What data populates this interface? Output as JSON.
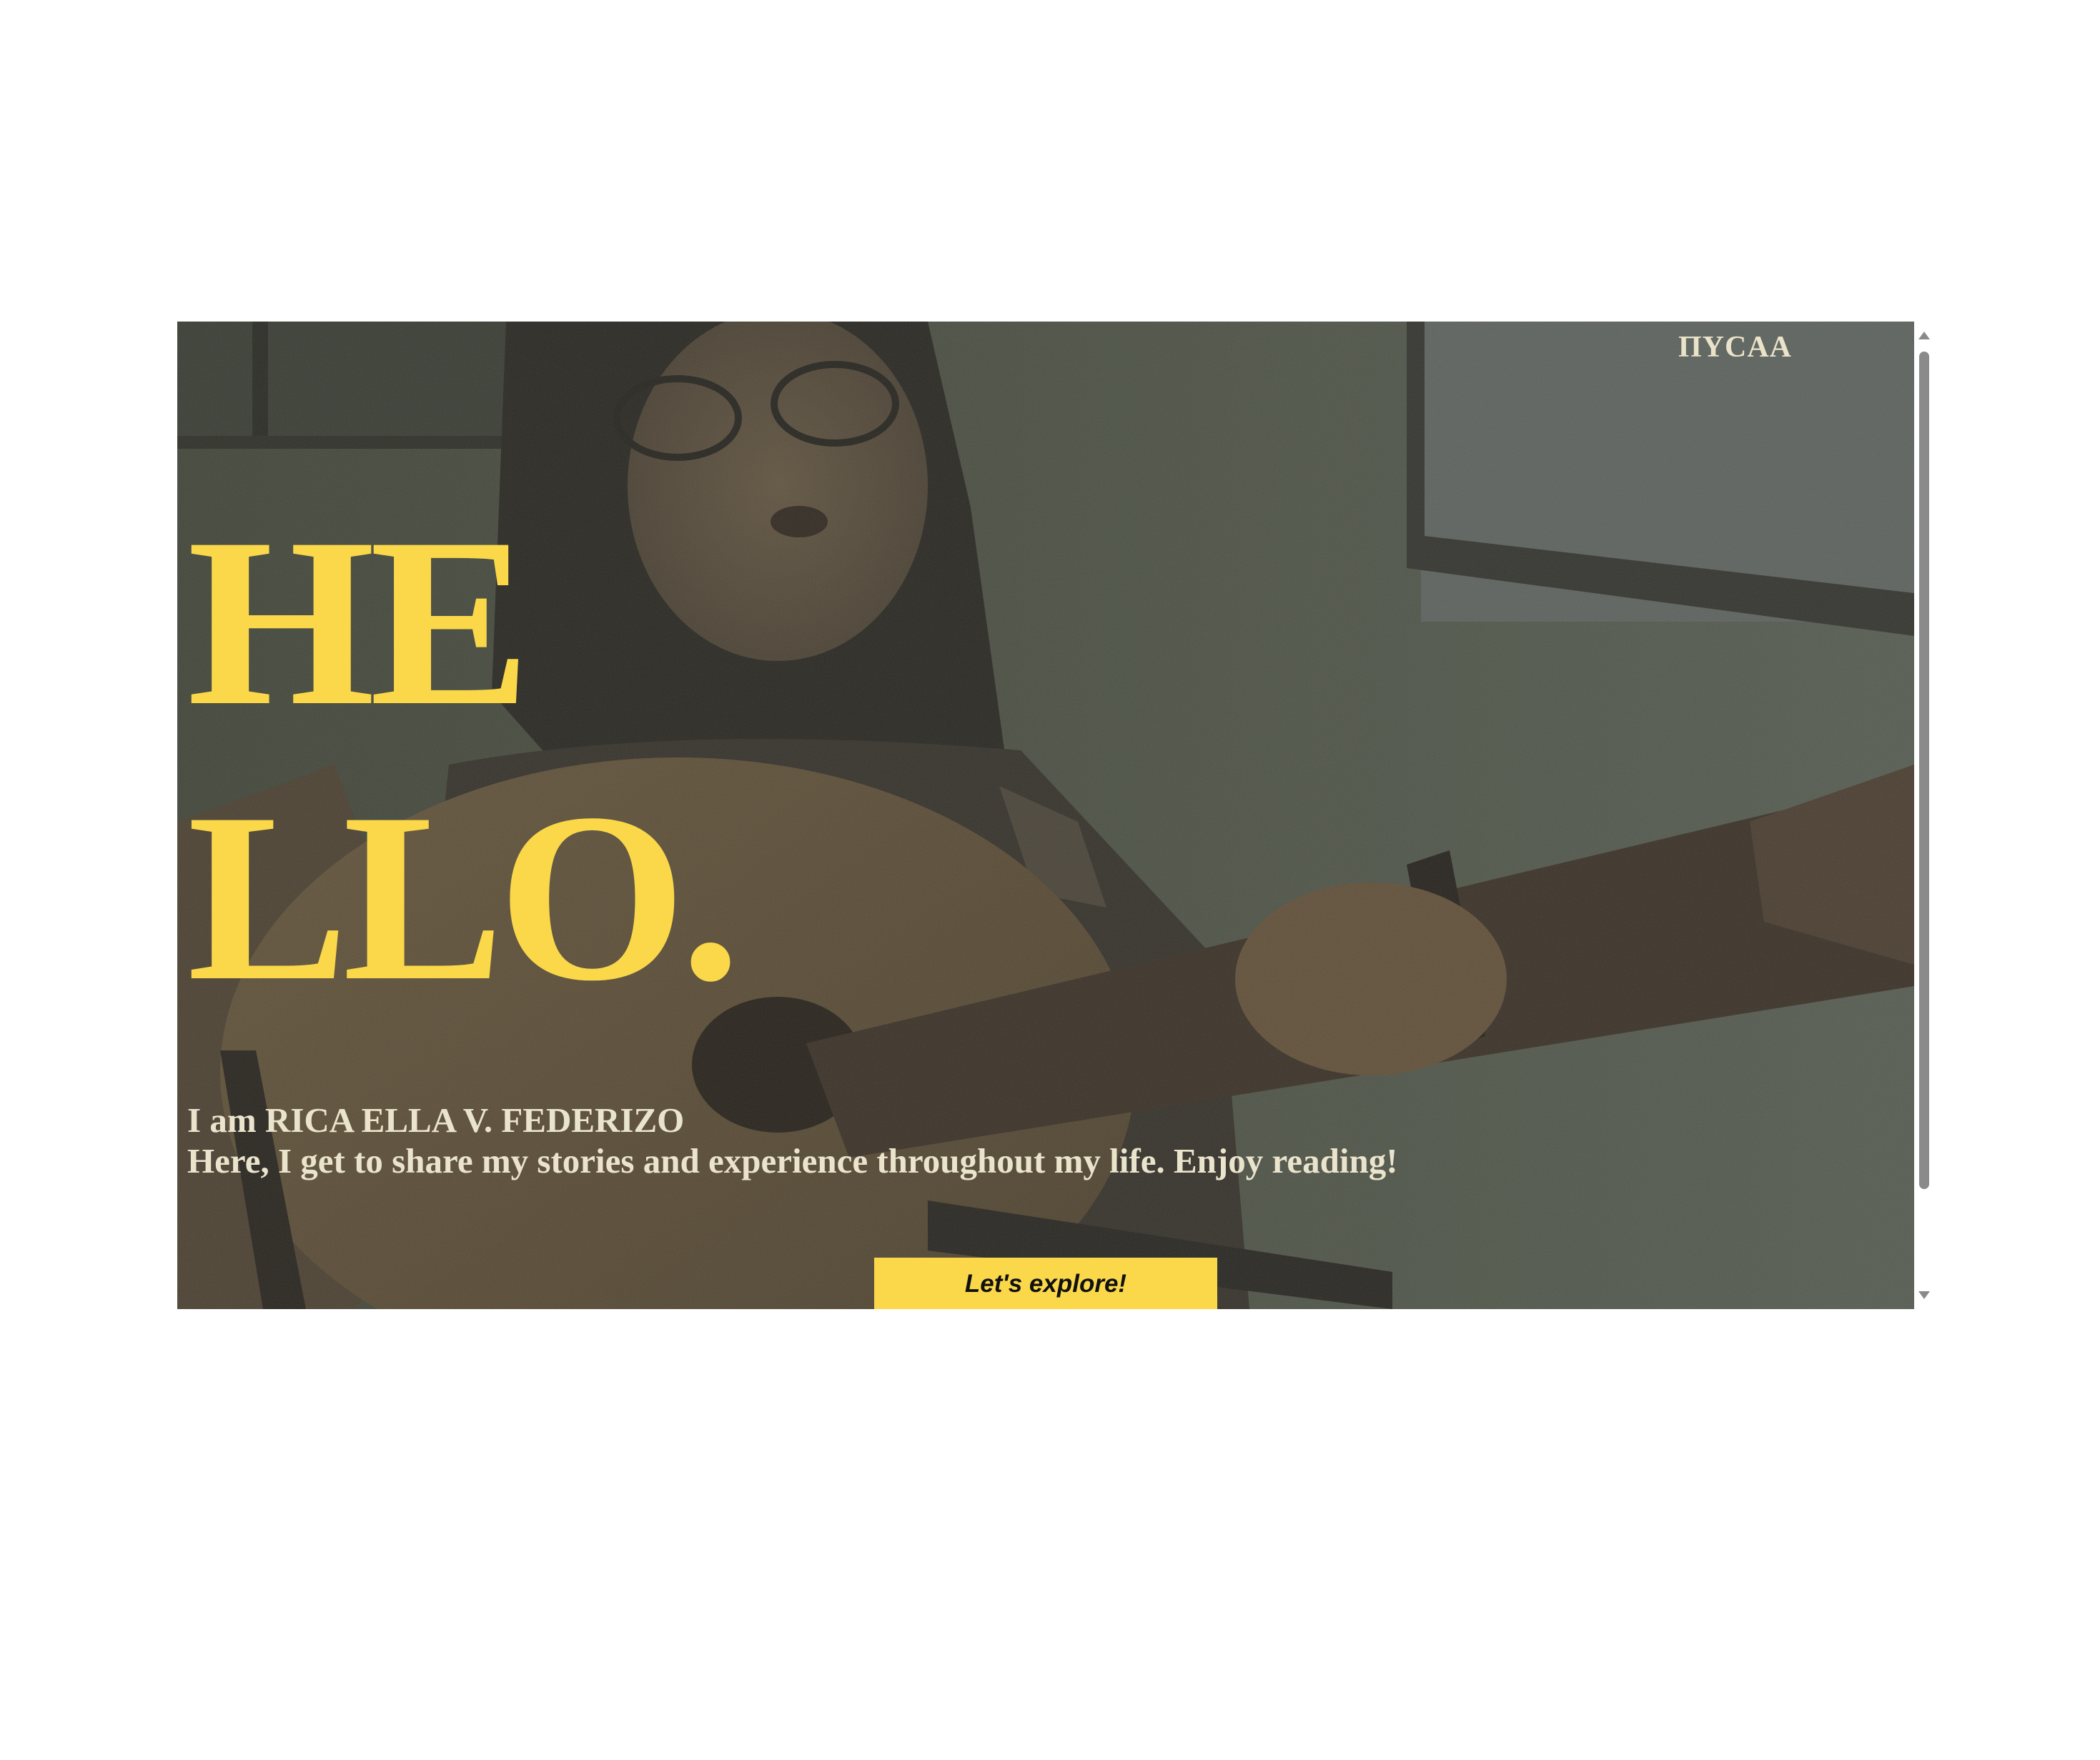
{
  "nav": {
    "logo": "ΠΥCAA"
  },
  "hero": {
    "line1": "HE",
    "line2": "LLO.",
    "name_line": "I am RICA ELLA V. FEDERIZO",
    "tagline": "Here, I get to share my stories and experience throughout my life. Enjoy reading!",
    "cta_label": "Let's explore!"
  },
  "colors": {
    "accent_yellow": "#fad84a",
    "light_text": "#ebe4cc",
    "scroll_thumb": "#8a8a8a"
  },
  "icons": {
    "scroll_up": "triangle-up-icon",
    "scroll_down": "triangle-down-icon"
  }
}
